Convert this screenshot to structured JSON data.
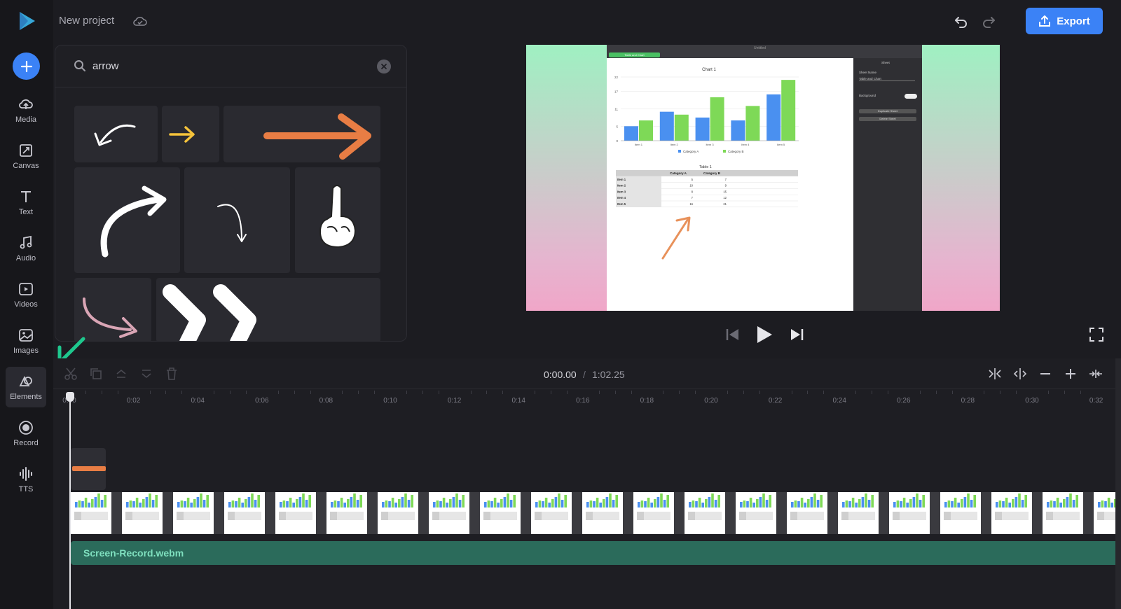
{
  "header": {
    "project_title": "New project",
    "export_label": "Export"
  },
  "rail": {
    "items": [
      {
        "label": "Media",
        "icon": "cloud-upload-icon"
      },
      {
        "label": "Canvas",
        "icon": "canvas-icon"
      },
      {
        "label": "Text",
        "icon": "text-icon"
      },
      {
        "label": "Audio",
        "icon": "music-note-icon"
      },
      {
        "label": "Videos",
        "icon": "video-play-icon"
      },
      {
        "label": "Images",
        "icon": "image-icon"
      },
      {
        "label": "Elements",
        "icon": "shapes-icon",
        "active": true
      },
      {
        "label": "Record",
        "icon": "record-icon"
      },
      {
        "label": "TTS",
        "icon": "waveform-icon"
      }
    ]
  },
  "search": {
    "value": "arrow",
    "placeholder": "Search"
  },
  "preview": {
    "doc_title": "Untitled",
    "sheet_tab": "Table and Chart",
    "sidebar": {
      "heading": "Sheet",
      "name_label": "Sheet Name",
      "name_value": "Table and Chart",
      "background_label": "Background",
      "duplicate_label": "Duplicate Sheet",
      "delete_label": "Delete Sheet"
    },
    "chart_title": "Chart 1",
    "table_title": "Table 1",
    "chart_data": {
      "type": "bar",
      "title": "Chart 1",
      "categories": [
        "Item 1",
        "Item 2",
        "Item 3",
        "Item 4",
        "Item 5"
      ],
      "series": [
        {
          "name": "Category A",
          "values": [
            5,
            10,
            8,
            7,
            16
          ]
        },
        {
          "name": "Category B",
          "values": [
            7,
            9,
            15,
            12,
            21
          ]
        }
      ],
      "y_ticks": [
        "0",
        "5",
        "11",
        "17",
        "22"
      ],
      "ylim": [
        0,
        22
      ],
      "legend": "bottom"
    },
    "table": {
      "headers": [
        "",
        "Category A",
        "Category B"
      ],
      "rows": [
        [
          "Item 1",
          "5",
          "7"
        ],
        [
          "Item 2",
          "10",
          "9"
        ],
        [
          "Item 3",
          "8",
          "15"
        ],
        [
          "Item 4",
          "7",
          "12"
        ],
        [
          "Item 5",
          "16",
          "21"
        ]
      ]
    }
  },
  "timeline": {
    "time_current": "0:00.00",
    "time_separator": "/",
    "time_total": "1:02.25",
    "ticks": [
      "0:00",
      "0:02",
      "0:04",
      "0:06",
      "0:08",
      "0:10",
      "0:12",
      "0:14",
      "0:16",
      "0:18",
      "0:20",
      "0:22",
      "0:24",
      "0:26",
      "0:28",
      "0:30",
      "0:32"
    ],
    "audio_clip_name": "Screen-Record.webm"
  },
  "colors": {
    "accent": "#3b82f6",
    "arrow_orange": "#e87d44",
    "audio_track": "#2b6b5b",
    "category_a": "#4a90f0",
    "category_b": "#7ed957"
  }
}
